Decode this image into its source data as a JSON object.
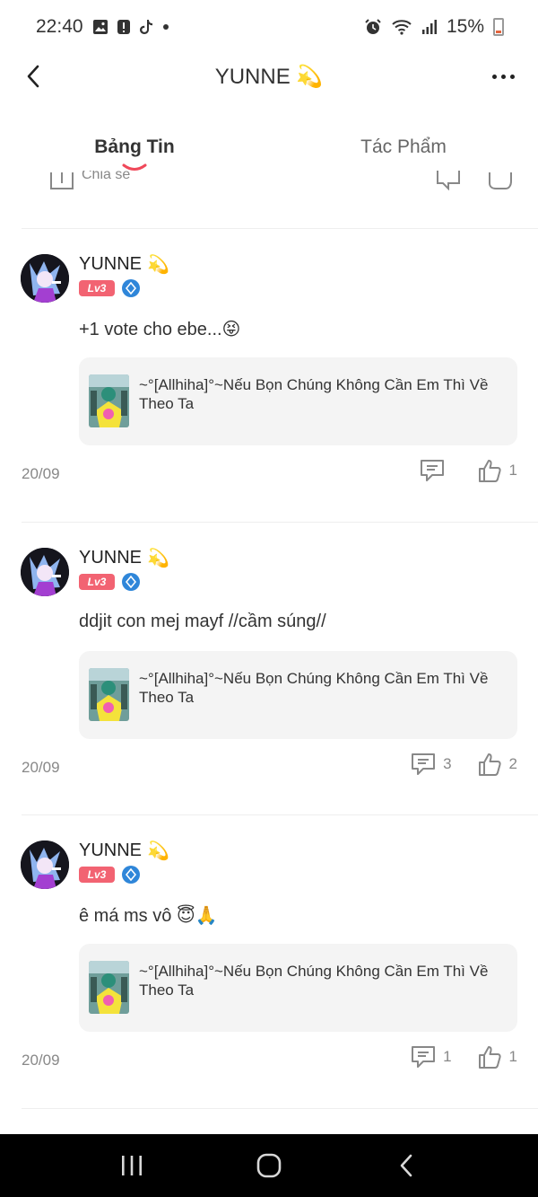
{
  "status_bar": {
    "time": "22:40",
    "battery": "15%"
  },
  "header": {
    "title": "YUNNE 💫"
  },
  "tabs": [
    {
      "label": "Bảng Tin",
      "active": true
    },
    {
      "label": "Tác Phẩm",
      "active": false
    }
  ],
  "partial_post": {
    "share_label": "Chia sẻ"
  },
  "posts": [
    {
      "username": "YUNNE",
      "username_emoji": "💫",
      "level": "Lv3",
      "text": "+1 vote cho ebe...😝",
      "card_title": "~°[Allhiha]°~Nếu Bọn Chúng Không Cần Em Thì Về Theo Ta",
      "date": "20/09",
      "comments": "",
      "likes": "1"
    },
    {
      "username": "YUNNE",
      "username_emoji": "💫",
      "level": "Lv3",
      "text": "ddjit con mej mayf //cầm súng//",
      "card_title": "~°[Allhiha]°~Nếu Bọn Chúng Không Cần Em Thì Về Theo Ta",
      "date": "20/09",
      "comments": "3",
      "likes": "2"
    },
    {
      "username": "YUNNE",
      "username_emoji": "💫",
      "level": "Lv3",
      "text": "ê má ms vô 😇🙏",
      "card_title": "~°[Allhiha]°~Nếu Bọn Chúng Không Cần Em Thì Về Theo Ta",
      "date": "20/09",
      "comments": "1",
      "likes": "1"
    }
  ],
  "colors": {
    "accent": "#f0485a",
    "level_badge": "#f26372",
    "verify_badge": "#2f86d9",
    "card_bg": "#f4f4f4",
    "nav_bar": "#000000"
  },
  "icons": {
    "back": "chevron-left-icon",
    "more": "more-horizontal-icon",
    "comment": "comment-icon",
    "like": "thumbs-up-icon",
    "verify": "verified-icon"
  }
}
